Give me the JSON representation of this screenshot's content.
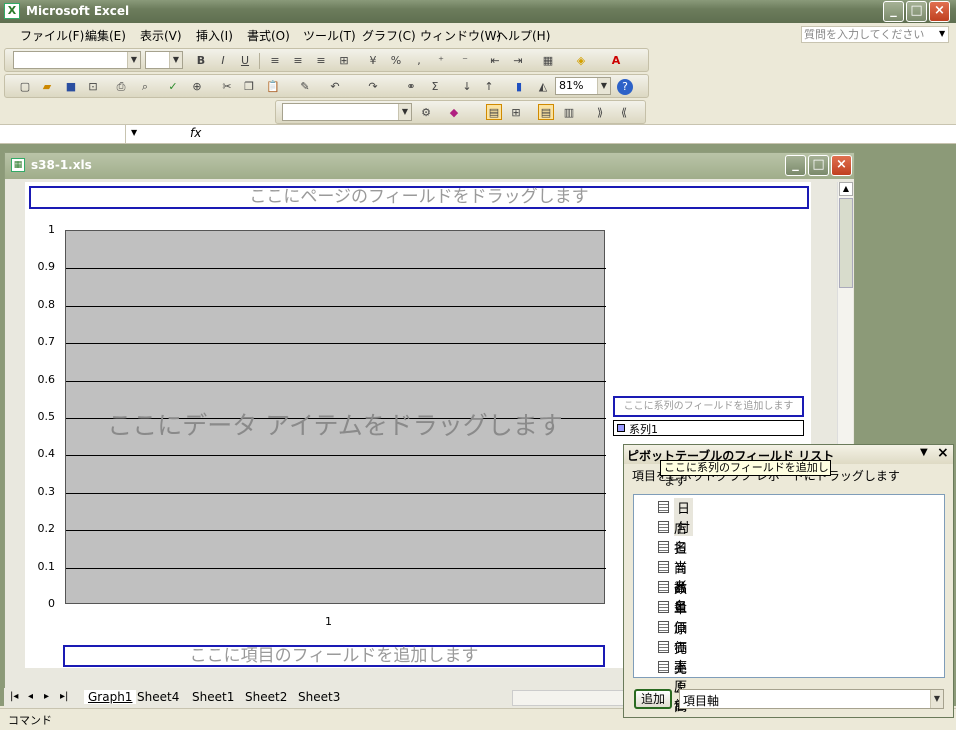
{
  "app": {
    "title": "Microsoft Excel",
    "icon": "excel-icon"
  },
  "menu": [
    "ファイル(F)",
    "編集(E)",
    "表示(V)",
    "挿入(I)",
    "書式(O)",
    "ツール(T)",
    "グラフ(C)",
    "ウィンドウ(W)",
    "ヘルプ(H)"
  ],
  "help_search": {
    "placeholder": "質問を入力してください"
  },
  "toolbar": {
    "zoom": "81%",
    "fx": "fx"
  },
  "workbook": {
    "title": "s38-1.xls"
  },
  "chart": {
    "page_field_drop": "ここにページのフィールドをドラッグします",
    "data_drop": "ここにデータ アイテムをドラッグします",
    "series_drop": "ここに系列のフィールドを追加します",
    "category_drop": "ここに項目のフィールドを追加します",
    "legend_entry": "系列1",
    "plot_color": "#C0C0C0"
  },
  "chart_data": {
    "type": "bar",
    "categories": [
      "1"
    ],
    "series": [
      {
        "name": "系列1",
        "values": [
          0
        ]
      }
    ],
    "yticks": [
      "0",
      "0.1",
      "0.2",
      "0.3",
      "0.4",
      "0.5",
      "0.6",
      "0.7",
      "0.8",
      "0.9",
      "1"
    ],
    "ylim": [
      0,
      1
    ],
    "grid": true,
    "legend": "right"
  },
  "sheets": [
    "Graph1",
    "Sheet4",
    "Sheet1",
    "Sheet2",
    "Sheet3"
  ],
  "status": {
    "mode": "コマンド"
  },
  "pivot": {
    "title": "ピボットテーブルのフィールド リスト",
    "instruction": "項目をピボットグラフ レポートにドラッグします",
    "tooltip": "ここに系列のフィールドを追加します",
    "fields": [
      "日付",
      "店名",
      "担当者",
      "商品名",
      "数量",
      "単価",
      "原価率",
      "売上原価",
      "売上高"
    ],
    "add_button": "追加",
    "target": "項目軸"
  }
}
